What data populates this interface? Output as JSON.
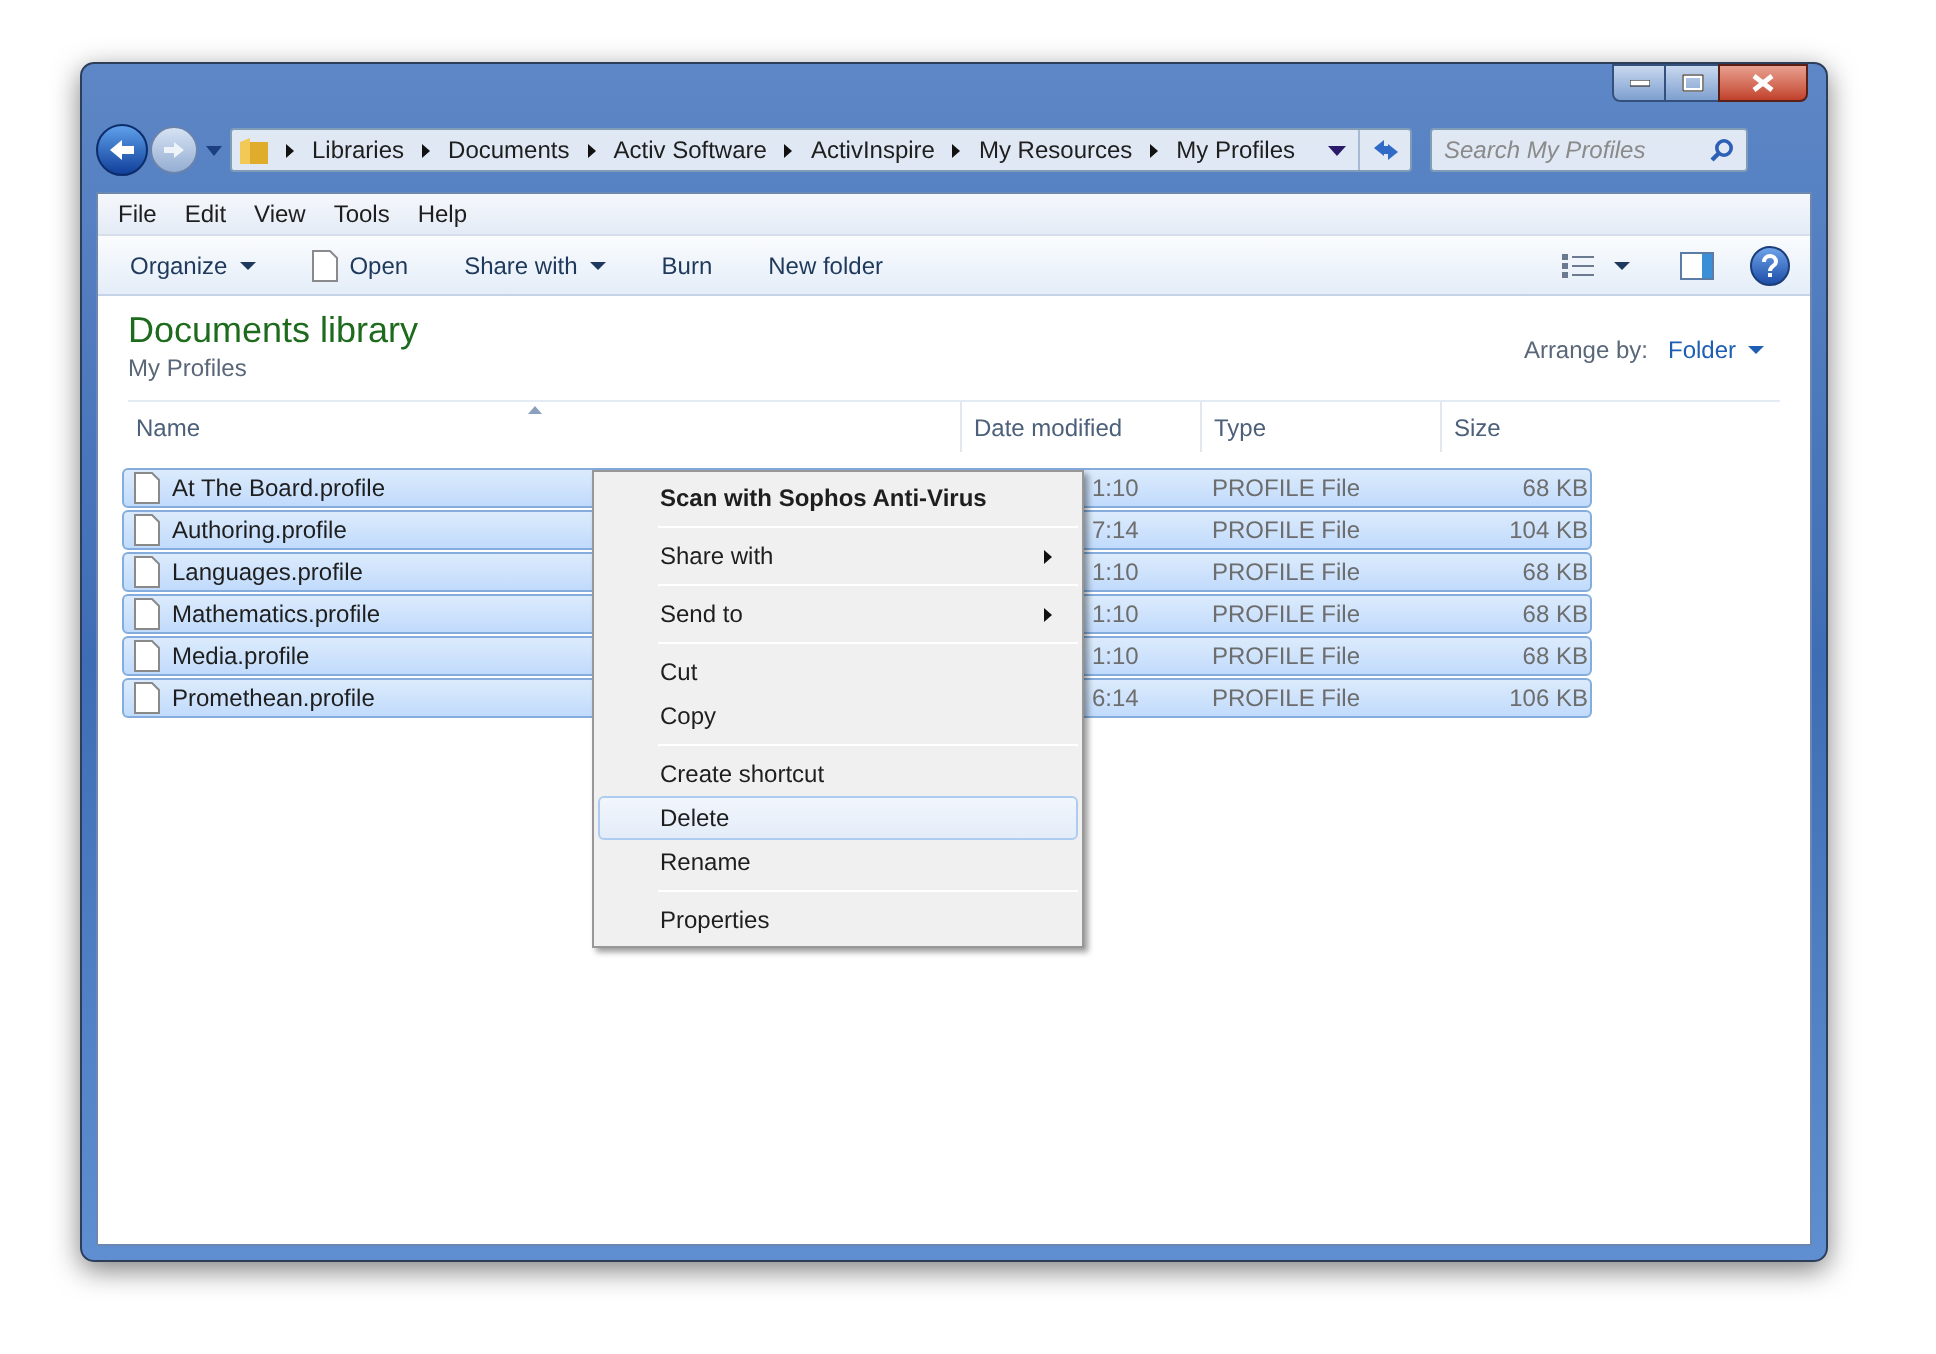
{
  "breadcrumbs": [
    "Libraries",
    "Documents",
    "Activ Software",
    "ActivInspire",
    "My Resources",
    "My Profiles"
  ],
  "search": {
    "placeholder": "Search My Profiles"
  },
  "menu_bar": [
    "File",
    "Edit",
    "View",
    "Tools",
    "Help"
  ],
  "toolbar": [
    {
      "label": "Organize",
      "dropdown": true,
      "icon": false
    },
    {
      "label": "Open",
      "dropdown": false,
      "icon": true
    },
    {
      "label": "Share with",
      "dropdown": true,
      "icon": false
    },
    {
      "label": "Burn",
      "dropdown": false,
      "icon": false
    },
    {
      "label": "New folder",
      "dropdown": false,
      "icon": false
    }
  ],
  "library": {
    "title": "Documents library",
    "subtitle": "My Profiles",
    "arrange_label": "Arrange by:",
    "arrange_value": "Folder"
  },
  "table": {
    "columns": [
      "Name",
      "Date modified",
      "Type",
      "Size"
    ],
    "rows": [
      {
        "name": "At The Board.profile",
        "date": "1:10",
        "type": "PROFILE File",
        "size": "68 KB",
        "selected": true
      },
      {
        "name": "Authoring.profile",
        "date": "7:14",
        "type": "PROFILE File",
        "size": "104 KB",
        "selected": true
      },
      {
        "name": "Languages.profile",
        "date": "1:10",
        "type": "PROFILE File",
        "size": "68 KB",
        "selected": true
      },
      {
        "name": "Mathematics.profile",
        "date": "1:10",
        "type": "PROFILE File",
        "size": "68 KB",
        "selected": true
      },
      {
        "name": "Media.profile",
        "date": "1:10",
        "type": "PROFILE File",
        "size": "68 KB",
        "selected": true
      },
      {
        "name": "Promethean.profile",
        "date": "6:14",
        "type": "PROFILE File",
        "size": "106 KB",
        "selected": true
      }
    ]
  },
  "context_menu": [
    [
      {
        "label": "Scan with Sophos Anti-Virus",
        "default": true,
        "submenu": false,
        "selected": false
      }
    ],
    [
      {
        "label": "Share with",
        "default": false,
        "submenu": true,
        "selected": false
      }
    ],
    [
      {
        "label": "Send to",
        "default": false,
        "submenu": true,
        "selected": false
      }
    ],
    [
      {
        "label": "Cut",
        "default": false,
        "submenu": false,
        "selected": false
      },
      {
        "label": "Copy",
        "default": false,
        "submenu": false,
        "selected": false
      }
    ],
    [
      {
        "label": "Create shortcut",
        "default": false,
        "submenu": false,
        "selected": false
      },
      {
        "label": "Delete",
        "default": false,
        "submenu": false,
        "selected": true
      },
      {
        "label": "Rename",
        "default": false,
        "submenu": false,
        "selected": false
      }
    ],
    [
      {
        "label": "Properties",
        "default": false,
        "submenu": false,
        "selected": false
      }
    ]
  ]
}
